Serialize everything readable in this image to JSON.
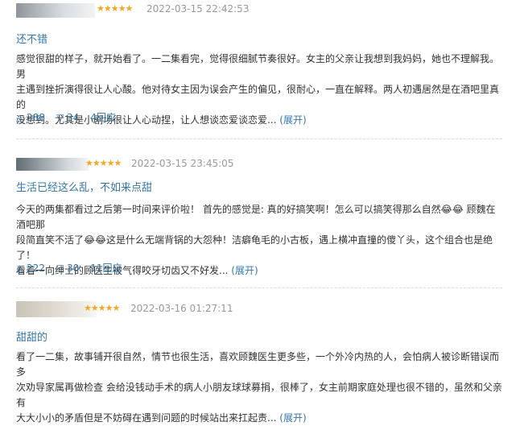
{
  "reviews": [
    {
      "stars": "★★★★★",
      "time": "2022-03-15 22:42:53",
      "title": "还不错",
      "lines": [
        "感觉很甜的样子，就开始看了。一二集看完，觉得很细腻节奏很好。女主的父亲让我想到我妈妈，她也不理解我。男",
        "主遇到挫折演得很让人心酸。他对待女主因为误会产生的偏见，很耐心，一直在解释。两人初遇居然是在酒吧里真的",
        "没想到。尤其是小剧场很让人心动捏，让人想谈恋爱谈恋爱..."
      ],
      "expand": "(展开)",
      "up": "△ 288",
      "down": "▽ 34",
      "replies": "4回应"
    },
    {
      "stars": "★★★★★",
      "time": "2022-03-15 23:45:05",
      "title": "生活已经这么乱，不如来点甜",
      "lines": [
        "今天的两集都看过之后第一时间来评价啦！ 首先的感觉是: 真的好搞笑啊！怎么可以搞笑得那么自然😂😂 顾魏在酒吧那",
        "段简直笑不活了😂😂这是什么无端背锅的大怨种！洁癖龟毛的小古板，遇上横冲直撞的傻丫头，这个组合也是绝了！",
        "看着一向绅士的顾医生被气得咬牙切齿又不好发..."
      ],
      "expand": "(展开)",
      "up": "△ 222",
      "down": "▽ 30",
      "replies": "11回应"
    },
    {
      "stars": "★★★★★",
      "time": "2022-03-16 01:27:11",
      "title": "甜甜的",
      "lines": [
        "看了一二集，故事铺开很自然，情节也很生活，喜欢顾魏医生更多些，一个外冷内热的人，会怕病人被诊断错误而多",
        "次劝导家属再做检查 会给没钱动手术的病人小朋友球球募捐，很棒了，女主前期家庭处理也很不错的，虽然和父亲有",
        "大大小小的矛盾但是不妨碍在遇到问题的时候站出来扛起责..."
      ],
      "expand": "(展开)"
    }
  ],
  "colors": {
    "link": "#3377aa",
    "star": "#f5a623",
    "meta": "#999999",
    "text": "#333333"
  }
}
